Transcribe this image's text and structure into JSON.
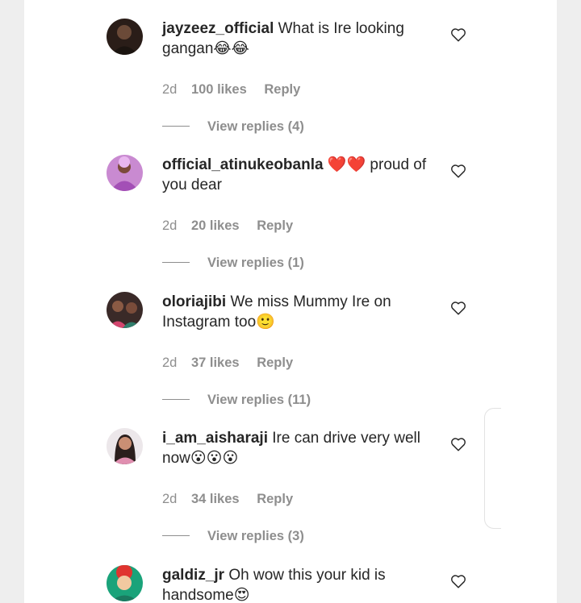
{
  "comments": [
    {
      "username": "jayzeez_official",
      "text": "What is Ire looking gangan😂😂",
      "time": "2d",
      "likes": "100 likes",
      "reply": "Reply",
      "view_replies": "View replies (4)"
    },
    {
      "username": "official_atinukeobanla",
      "text": "❤️❤️ proud of you dear",
      "time": "2d",
      "likes": "20 likes",
      "reply": "Reply",
      "view_replies": "View replies (1)"
    },
    {
      "username": "oloriajibi",
      "text": "We miss Mummy Ire on Instagram too🙂",
      "time": "2d",
      "likes": "37 likes",
      "reply": "Reply",
      "view_replies": "View replies (11)"
    },
    {
      "username": "i_am_aisharaji",
      "text": "Ire can drive very well now😮😮😮",
      "time": "2d",
      "likes": "34 likes",
      "reply": "Reply",
      "view_replies": "View replies (3)"
    },
    {
      "username": "galdiz_jr",
      "text": "Oh wow this your kid is handsome😍"
    }
  ],
  "icons": {
    "like": "heart-outline-icon"
  },
  "colors": {
    "text": "#262626",
    "secondary": "#8e8e8e",
    "background": "#eeeeee"
  }
}
